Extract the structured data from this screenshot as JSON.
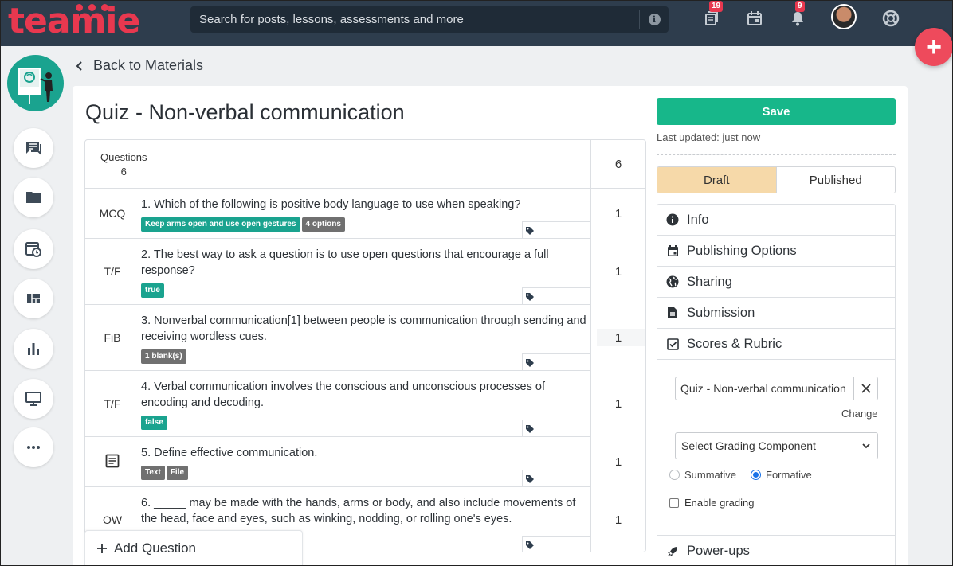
{
  "brand": {
    "logo_text": "teamie",
    "accent": "#e8384f",
    "topbar_bg": "#2e3d4d"
  },
  "search": {
    "placeholder": "Search for posts, lessons, assessments and more"
  },
  "topbar": {
    "icons": [
      {
        "name": "materials-icon",
        "badge": "19"
      },
      {
        "name": "calendar-icon",
        "badge": ""
      },
      {
        "name": "bell-icon",
        "badge": "9"
      },
      {
        "name": "avatar",
        "badge": ""
      },
      {
        "name": "help-lifebuoy-icon",
        "badge": ""
      }
    ],
    "fab_label": "+"
  },
  "sidebar": {
    "items": [
      "chat-icon",
      "folder-icon",
      "schedule-icon",
      "dashboard-icon",
      "bar-chart-icon",
      "monitor-icon",
      "more-icon"
    ]
  },
  "nav": {
    "back_label": "Back to Materials"
  },
  "quiz": {
    "title": "Quiz - Non-verbal communication",
    "questions_label": "Questions",
    "questions_count": "6",
    "total_score": "6",
    "add_question_label": "Add Question",
    "rows": [
      {
        "type": "MCQ",
        "text": "1. Which of the following is positive body language to use when speaking?",
        "tags": [
          {
            "label": "Keep arms open and use open gestures",
            "color": "green"
          },
          {
            "label": "4 options",
            "color": "grey"
          }
        ],
        "score": "1"
      },
      {
        "type": "T/F",
        "text": "2. The best way to ask a question is to use open questions that encourage a full response?",
        "tags": [
          {
            "label": "true",
            "color": "green"
          }
        ],
        "score": "1"
      },
      {
        "type": "FiB",
        "text": "3. Nonverbal communication[1] between people is communication through sending and receiving wordless cues.",
        "tags": [
          {
            "label": "1 blank(s)",
            "color": "grey"
          }
        ],
        "score": "1"
      },
      {
        "type": "T/F",
        "text": "4. Verbal communication involves the conscious and unconscious processes of encoding and decoding.",
        "tags": [
          {
            "label": "false",
            "color": "green"
          }
        ],
        "score": "1"
      },
      {
        "type": "document-icon",
        "text": "5. Define effective communication.",
        "tags": [
          {
            "label": "Text",
            "color": "grey"
          },
          {
            "label": "File",
            "color": "grey"
          }
        ],
        "score": "1"
      },
      {
        "type": "OW",
        "text": "6. _____ may be made with the hands, arms or body, and also include movements of the head, face and eyes, such as winking, nodding, or rolling one's eyes.",
        "tags": [],
        "score": "1"
      }
    ]
  },
  "panel": {
    "save_label": "Save",
    "last_updated": "Last updated: just now",
    "status": {
      "draft": "Draft",
      "published": "Published",
      "active": "Draft"
    },
    "accordion": [
      "Info",
      "Publishing Options",
      "Sharing",
      "Submission",
      "Scores & Rubric"
    ],
    "scores": {
      "selected_quiz": "Quiz - Non-verbal communication",
      "change_label": "Change",
      "grading_placeholder": "Select Grading Component",
      "summative_label": "Summative",
      "formative_label": "Formative",
      "selected_type": "Formative",
      "enable_grading_label": "Enable grading"
    },
    "powerups_label": "Power-ups"
  },
  "colors": {
    "save": "#17b78a",
    "draft": "#f6d9a9",
    "tag_green": "#1aa38f",
    "tag_grey": "#707070"
  }
}
